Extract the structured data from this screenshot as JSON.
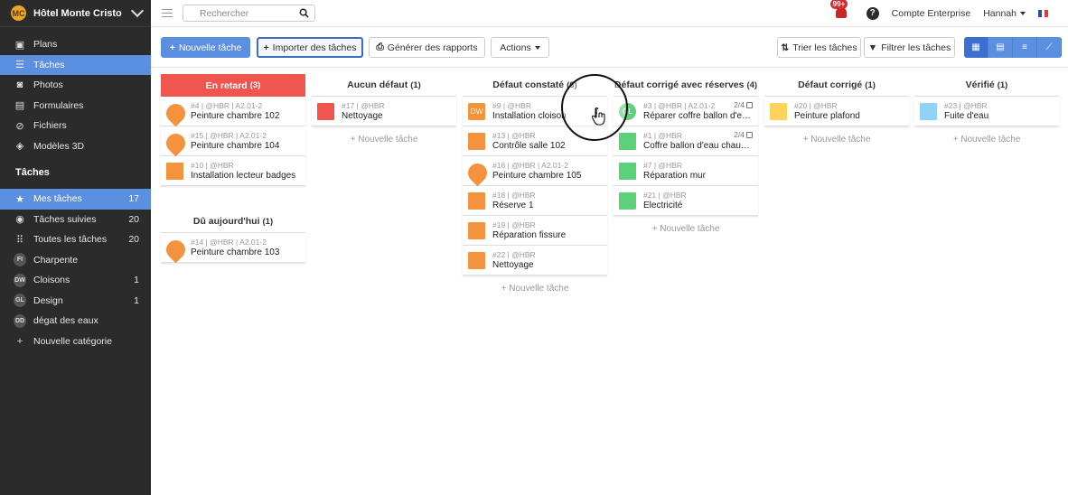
{
  "sidebar": {
    "hotel": "Hôtel Monte Cristo",
    "logo_text": "MC",
    "nav": [
      {
        "label": "Plans",
        "icon": "map-icon",
        "glyph": "▣"
      },
      {
        "label": "Tâches",
        "icon": "list-icon",
        "glyph": "☰",
        "active": true
      },
      {
        "label": "Photos",
        "icon": "camera-icon",
        "glyph": "◙"
      },
      {
        "label": "Formulaires",
        "icon": "form-icon",
        "glyph": "▤"
      },
      {
        "label": "Fichiers",
        "icon": "paperclip-icon",
        "glyph": "⊘"
      },
      {
        "label": "Modèles 3D",
        "icon": "cube-icon",
        "glyph": "◈"
      }
    ],
    "section": "Tâches",
    "tasks": [
      {
        "label": "Mes tâches",
        "count": "17",
        "icon": "star-icon",
        "glyph": "★",
        "active": true
      },
      {
        "label": "Tâches suivies",
        "count": "20",
        "icon": "eye-icon",
        "glyph": "◉"
      },
      {
        "label": "Toutes les tâches",
        "count": "20",
        "icon": "grid-icon",
        "glyph": "⠿"
      }
    ],
    "categories": [
      {
        "label": "Charpente",
        "avatar": "FI",
        "count": ""
      },
      {
        "label": "Cloisons",
        "avatar": "DW",
        "count": "1"
      },
      {
        "label": "Design",
        "avatar": "GL",
        "count": "1"
      },
      {
        "label": "dégat des eaux",
        "avatar": "DD",
        "count": ""
      }
    ],
    "new_category": "Nouvelle catégorie"
  },
  "topbar": {
    "search_placeholder": "Rechercher",
    "notif_count": "99+",
    "help": "?",
    "account": "Compte Enterprise",
    "user": "Hannah"
  },
  "toolbar": {
    "new_task": "Nouvelle tâche",
    "import": "Importer des tâches",
    "reports": "Générer des rapports",
    "actions": "Actions",
    "sort": "Trier les tâches",
    "filter": "Filtrer les tâches"
  },
  "colors": {
    "red": "#f0554e",
    "orange": "#f5923e",
    "green": "#5bd27a",
    "yellow": "#fdd35c",
    "lightblue": "#8fd4f7",
    "blue": "#5b8fe0"
  },
  "columns": [
    {
      "title": "En retard",
      "count": "(3)",
      "style": "late",
      "cards": [
        {
          "meta": "#4 | @HBR | A2.01-2",
          "title": "Peinture chambre 102",
          "marker": "pin",
          "color": "#f5923e"
        },
        {
          "meta": "#15 | @HBR | A2.01-2",
          "title": "Peinture chambre 104",
          "marker": "pin",
          "color": "#f5923e"
        },
        {
          "meta": "#10 | @HBR",
          "title": "Installation lecteur badges",
          "marker": "square",
          "color": "#f5923e"
        }
      ],
      "new_task": ""
    },
    {
      "title": "Aucun défaut",
      "count": "(1)",
      "cards": [
        {
          "meta": "#17 | @HBR",
          "title": "Nettoyage",
          "marker": "square",
          "color": "#f0554e"
        }
      ],
      "new_task": "+ Nouvelle tâche"
    },
    {
      "title": "Défaut constaté",
      "count": "(6)",
      "cards": [
        {
          "meta": "#9 | @HBR",
          "title": "Installation cloison",
          "marker": "avatar",
          "avatar": "DW",
          "color": "#f5923e"
        },
        {
          "meta": "#13 | @HBR",
          "title": "Contrôle salle 102",
          "marker": "square",
          "color": "#f5923e"
        },
        {
          "meta": "#16 | @HBR | A2.01-2",
          "title": "Peinture chambre 105",
          "marker": "pin",
          "color": "#f5923e"
        },
        {
          "meta": "#18 | @HBR",
          "title": "Réserve 1",
          "marker": "square",
          "color": "#f5923e"
        },
        {
          "meta": "#19 | @HBR",
          "title": "Réparation fissure",
          "marker": "square",
          "color": "#f5923e"
        },
        {
          "meta": "#22 | @HBR",
          "title": "Nettoyage",
          "marker": "square",
          "color": "#f5923e"
        }
      ],
      "new_task": "+ Nouvelle tâche"
    },
    {
      "title": "Défaut corrigé avec réserves",
      "count": "(4)",
      "cards": [
        {
          "meta": "#3 | @HBR | A2.01-2",
          "title": "Réparer coffre ballon d'eau chaude",
          "marker": "avatar-round",
          "avatar": "GL",
          "color": "#5bd27a",
          "check": "2/4"
        },
        {
          "meta": "#1 | @HBR",
          "title": "Coffre ballon d'eau chaude à réparer",
          "marker": "square",
          "color": "#5bd27a",
          "check": "2/4"
        },
        {
          "meta": "#7 | @HBR",
          "title": "Réparation mur",
          "marker": "square",
          "color": "#5bd27a"
        },
        {
          "meta": "#21 | @HBR",
          "title": "Electricité",
          "marker": "square",
          "color": "#5bd27a"
        }
      ],
      "new_task": "+ Nouvelle tâche"
    },
    {
      "title": "Défaut corrigé",
      "count": "(1)",
      "cards": [
        {
          "meta": "#20 | @HBR",
          "title": "Peinture plafond",
          "marker": "square",
          "color": "#fdd35c"
        }
      ],
      "new_task": "+ Nouvelle tâche"
    },
    {
      "title": "Vérifié",
      "count": "(1)",
      "cards": [
        {
          "meta": "#23 | @HBR",
          "title": "Fuite d'eau",
          "marker": "square",
          "color": "#8fd4f7"
        }
      ],
      "new_task": "+ Nouvelle tâche"
    }
  ],
  "due_today": {
    "title": "Dû aujourd'hui",
    "count": "(1)",
    "cards": [
      {
        "meta": "#14 | @HBR | A2.01-2",
        "title": "Peinture chambre 103",
        "marker": "pin",
        "color": "#f5923e"
      }
    ]
  }
}
